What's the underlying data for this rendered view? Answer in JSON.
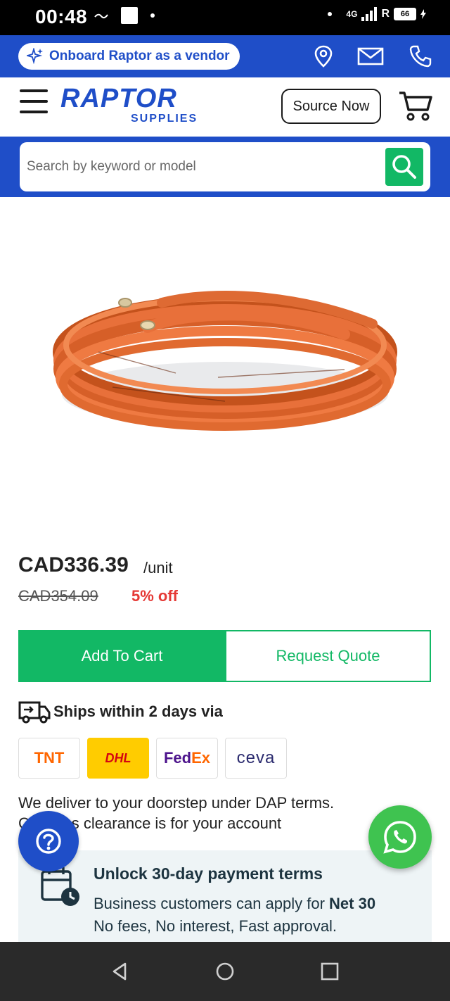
{
  "status_bar": {
    "time": "00:48",
    "network": "4G",
    "roaming": "R",
    "battery": "66"
  },
  "top_strip": {
    "vendor_label": "Onboard Raptor as a vendor"
  },
  "header": {
    "logo_word": "RAPTOR",
    "logo_sub": "SUPPLIES",
    "source_now": "Source Now"
  },
  "search": {
    "placeholder": "Search by keyword or model"
  },
  "product": {
    "price": "CAD336.39",
    "unit": "/unit",
    "old_price": "CAD354.09",
    "discount": "5% off"
  },
  "actions": {
    "add_to_cart": "Add To Cart",
    "request_quote": "Request Quote"
  },
  "shipping": {
    "ships_text": "Ships within 2 days via",
    "carriers": [
      "TNT",
      "DHL",
      "FedEx",
      "ceva"
    ],
    "deliver_line1": "We deliver to your doorstep under DAP terms.",
    "deliver_line2": "Customs clearance is for your account"
  },
  "payment": {
    "title": "Unlock 30-day payment terms",
    "line1_prefix": "Business customers can apply for ",
    "line1_bold": "Net 30",
    "line2": "No fees, No interest, Fast approval."
  },
  "colors": {
    "brand_blue": "#1f4ec8",
    "brand_green": "#12b865",
    "discount_red": "#e53935",
    "whatsapp_green": "#3fc350"
  }
}
